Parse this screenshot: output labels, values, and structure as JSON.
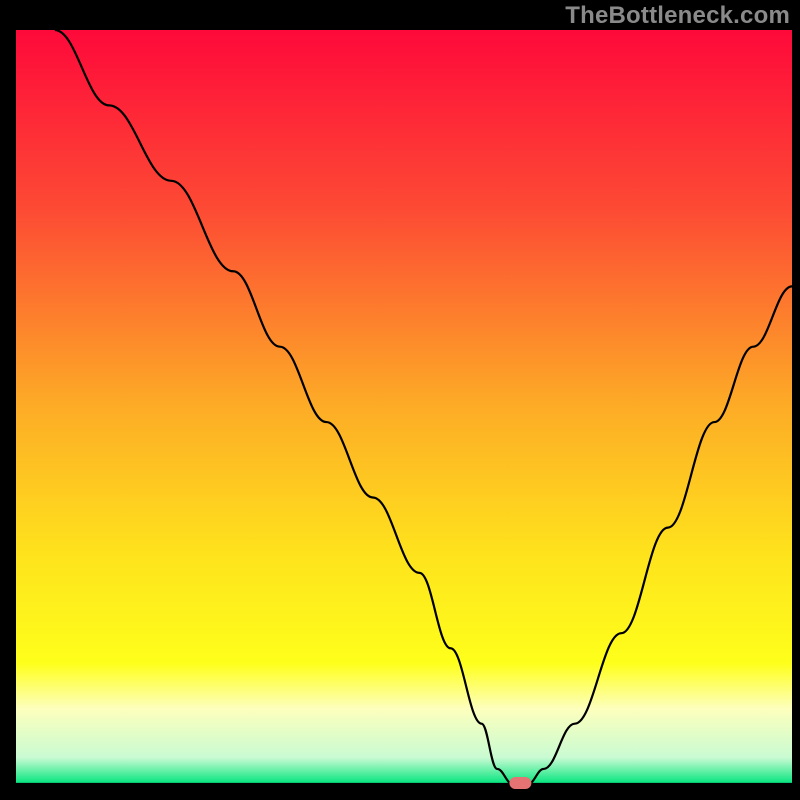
{
  "watermark": "TheBottleneck.com",
  "chart_data": {
    "type": "line",
    "title": "",
    "xlabel": "",
    "ylabel": "",
    "xlim": [
      0,
      100
    ],
    "ylim": [
      0,
      100
    ],
    "grid": false,
    "legend": false,
    "series": [
      {
        "name": "bottleneck-curve",
        "x": [
          5,
          12,
          20,
          28,
          34,
          40,
          46,
          52,
          56,
          60,
          62,
          64,
          66,
          68,
          72,
          78,
          84,
          90,
          95,
          100
        ],
        "y": [
          100,
          90,
          80,
          68,
          58,
          48,
          38,
          28,
          18,
          8,
          2,
          0,
          0,
          2,
          8,
          20,
          34,
          48,
          58,
          66
        ]
      }
    ],
    "marker": {
      "name": "optimal-point",
      "x": 65,
      "y": 0,
      "color": "#e57373"
    },
    "baseline": {
      "green_band_top": 3.5,
      "yellow_band_top": 10
    },
    "gradient_stops": [
      {
        "offset": 0,
        "color": "#fe093a"
      },
      {
        "offset": 24,
        "color": "#fd4b34"
      },
      {
        "offset": 50,
        "color": "#fdac26"
      },
      {
        "offset": 70,
        "color": "#fee41c"
      },
      {
        "offset": 84,
        "color": "#feff1b"
      },
      {
        "offset": 90,
        "color": "#fdffbd"
      },
      {
        "offset": 96.5,
        "color": "#c9fbd2"
      },
      {
        "offset": 100,
        "color": "#00e47c"
      }
    ]
  }
}
